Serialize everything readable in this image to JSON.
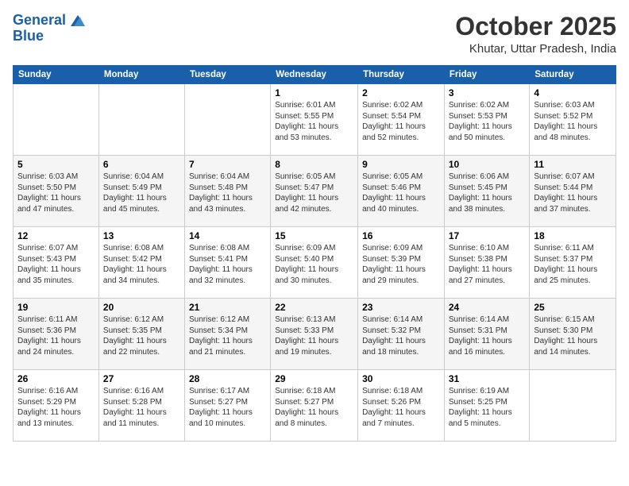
{
  "header": {
    "logo_line1": "General",
    "logo_line2": "Blue",
    "month": "October 2025",
    "location": "Khutar, Uttar Pradesh, India"
  },
  "days_of_week": [
    "Sunday",
    "Monday",
    "Tuesday",
    "Wednesday",
    "Thursday",
    "Friday",
    "Saturday"
  ],
  "weeks": [
    [
      {
        "day": "",
        "sunrise": "",
        "sunset": "",
        "daylight": ""
      },
      {
        "day": "",
        "sunrise": "",
        "sunset": "",
        "daylight": ""
      },
      {
        "day": "",
        "sunrise": "",
        "sunset": "",
        "daylight": ""
      },
      {
        "day": "1",
        "sunrise": "Sunrise: 6:01 AM",
        "sunset": "Sunset: 5:55 PM",
        "daylight": "Daylight: 11 hours and 53 minutes."
      },
      {
        "day": "2",
        "sunrise": "Sunrise: 6:02 AM",
        "sunset": "Sunset: 5:54 PM",
        "daylight": "Daylight: 11 hours and 52 minutes."
      },
      {
        "day": "3",
        "sunrise": "Sunrise: 6:02 AM",
        "sunset": "Sunset: 5:53 PM",
        "daylight": "Daylight: 11 hours and 50 minutes."
      },
      {
        "day": "4",
        "sunrise": "Sunrise: 6:03 AM",
        "sunset": "Sunset: 5:52 PM",
        "daylight": "Daylight: 11 hours and 48 minutes."
      }
    ],
    [
      {
        "day": "5",
        "sunrise": "Sunrise: 6:03 AM",
        "sunset": "Sunset: 5:50 PM",
        "daylight": "Daylight: 11 hours and 47 minutes."
      },
      {
        "day": "6",
        "sunrise": "Sunrise: 6:04 AM",
        "sunset": "Sunset: 5:49 PM",
        "daylight": "Daylight: 11 hours and 45 minutes."
      },
      {
        "day": "7",
        "sunrise": "Sunrise: 6:04 AM",
        "sunset": "Sunset: 5:48 PM",
        "daylight": "Daylight: 11 hours and 43 minutes."
      },
      {
        "day": "8",
        "sunrise": "Sunrise: 6:05 AM",
        "sunset": "Sunset: 5:47 PM",
        "daylight": "Daylight: 11 hours and 42 minutes."
      },
      {
        "day": "9",
        "sunrise": "Sunrise: 6:05 AM",
        "sunset": "Sunset: 5:46 PM",
        "daylight": "Daylight: 11 hours and 40 minutes."
      },
      {
        "day": "10",
        "sunrise": "Sunrise: 6:06 AM",
        "sunset": "Sunset: 5:45 PM",
        "daylight": "Daylight: 11 hours and 38 minutes."
      },
      {
        "day": "11",
        "sunrise": "Sunrise: 6:07 AM",
        "sunset": "Sunset: 5:44 PM",
        "daylight": "Daylight: 11 hours and 37 minutes."
      }
    ],
    [
      {
        "day": "12",
        "sunrise": "Sunrise: 6:07 AM",
        "sunset": "Sunset: 5:43 PM",
        "daylight": "Daylight: 11 hours and 35 minutes."
      },
      {
        "day": "13",
        "sunrise": "Sunrise: 6:08 AM",
        "sunset": "Sunset: 5:42 PM",
        "daylight": "Daylight: 11 hours and 34 minutes."
      },
      {
        "day": "14",
        "sunrise": "Sunrise: 6:08 AM",
        "sunset": "Sunset: 5:41 PM",
        "daylight": "Daylight: 11 hours and 32 minutes."
      },
      {
        "day": "15",
        "sunrise": "Sunrise: 6:09 AM",
        "sunset": "Sunset: 5:40 PM",
        "daylight": "Daylight: 11 hours and 30 minutes."
      },
      {
        "day": "16",
        "sunrise": "Sunrise: 6:09 AM",
        "sunset": "Sunset: 5:39 PM",
        "daylight": "Daylight: 11 hours and 29 minutes."
      },
      {
        "day": "17",
        "sunrise": "Sunrise: 6:10 AM",
        "sunset": "Sunset: 5:38 PM",
        "daylight": "Daylight: 11 hours and 27 minutes."
      },
      {
        "day": "18",
        "sunrise": "Sunrise: 6:11 AM",
        "sunset": "Sunset: 5:37 PM",
        "daylight": "Daylight: 11 hours and 25 minutes."
      }
    ],
    [
      {
        "day": "19",
        "sunrise": "Sunrise: 6:11 AM",
        "sunset": "Sunset: 5:36 PM",
        "daylight": "Daylight: 11 hours and 24 minutes."
      },
      {
        "day": "20",
        "sunrise": "Sunrise: 6:12 AM",
        "sunset": "Sunset: 5:35 PM",
        "daylight": "Daylight: 11 hours and 22 minutes."
      },
      {
        "day": "21",
        "sunrise": "Sunrise: 6:12 AM",
        "sunset": "Sunset: 5:34 PM",
        "daylight": "Daylight: 11 hours and 21 minutes."
      },
      {
        "day": "22",
        "sunrise": "Sunrise: 6:13 AM",
        "sunset": "Sunset: 5:33 PM",
        "daylight": "Daylight: 11 hours and 19 minutes."
      },
      {
        "day": "23",
        "sunrise": "Sunrise: 6:14 AM",
        "sunset": "Sunset: 5:32 PM",
        "daylight": "Daylight: 11 hours and 18 minutes."
      },
      {
        "day": "24",
        "sunrise": "Sunrise: 6:14 AM",
        "sunset": "Sunset: 5:31 PM",
        "daylight": "Daylight: 11 hours and 16 minutes."
      },
      {
        "day": "25",
        "sunrise": "Sunrise: 6:15 AM",
        "sunset": "Sunset: 5:30 PM",
        "daylight": "Daylight: 11 hours and 14 minutes."
      }
    ],
    [
      {
        "day": "26",
        "sunrise": "Sunrise: 6:16 AM",
        "sunset": "Sunset: 5:29 PM",
        "daylight": "Daylight: 11 hours and 13 minutes."
      },
      {
        "day": "27",
        "sunrise": "Sunrise: 6:16 AM",
        "sunset": "Sunset: 5:28 PM",
        "daylight": "Daylight: 11 hours and 11 minutes."
      },
      {
        "day": "28",
        "sunrise": "Sunrise: 6:17 AM",
        "sunset": "Sunset: 5:27 PM",
        "daylight": "Daylight: 11 hours and 10 minutes."
      },
      {
        "day": "29",
        "sunrise": "Sunrise: 6:18 AM",
        "sunset": "Sunset: 5:27 PM",
        "daylight": "Daylight: 11 hours and 8 minutes."
      },
      {
        "day": "30",
        "sunrise": "Sunrise: 6:18 AM",
        "sunset": "Sunset: 5:26 PM",
        "daylight": "Daylight: 11 hours and 7 minutes."
      },
      {
        "day": "31",
        "sunrise": "Sunrise: 6:19 AM",
        "sunset": "Sunset: 5:25 PM",
        "daylight": "Daylight: 11 hours and 5 minutes."
      },
      {
        "day": "",
        "sunrise": "",
        "sunset": "",
        "daylight": ""
      }
    ]
  ]
}
